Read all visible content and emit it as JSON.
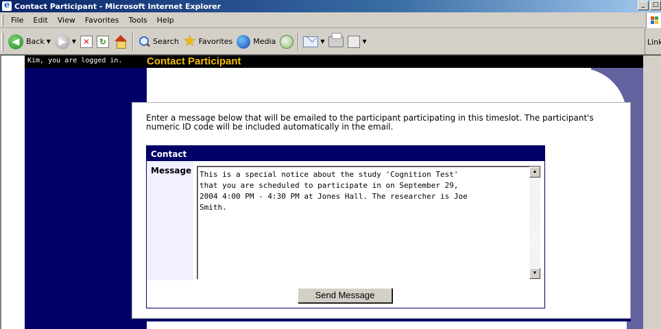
{
  "window": {
    "title": "Contact Participant - Microsoft Internet Explorer",
    "min_glyph": "_",
    "max_glyph": "□"
  },
  "menu": [
    {
      "key": "F",
      "rest": "ile"
    },
    {
      "key": "E",
      "rest": "dit"
    },
    {
      "key": "V",
      "rest": "iew"
    },
    {
      "key": "F",
      "rest": "avorites",
      "prefix": ""
    },
    {
      "key": "T",
      "rest": "ools"
    },
    {
      "key": "H",
      "rest": "elp"
    }
  ],
  "menu_labels": {
    "file": "File",
    "edit": "Edit",
    "view": "View",
    "favorites": "Favorites",
    "tools": "Tools",
    "help": "Help"
  },
  "toolbar": {
    "back": "Back",
    "search": "Search",
    "favorites": "Favorites",
    "media": "Media",
    "links": "Link"
  },
  "page": {
    "login_status": "Kim, you are logged in.",
    "title": "Contact Participant",
    "intro": "Enter a message below that will be emailed to the participant participating in this timeslot. The participant's numeric ID code will be included automatically in the email.",
    "contact_header": "Contact",
    "message_label": "Message",
    "message_value": "This is a special notice about the study 'Cognition Test'\nthat you are scheduled to participate in on September 29,\n2004 4:00 PM - 4:30 PM at Jones Hall. The researcher is Joe\nSmith.",
    "send_button": "Send Message"
  },
  "colors": {
    "navy": "#000066",
    "title_gold": "#f6be10",
    "purple": "#62629e"
  }
}
